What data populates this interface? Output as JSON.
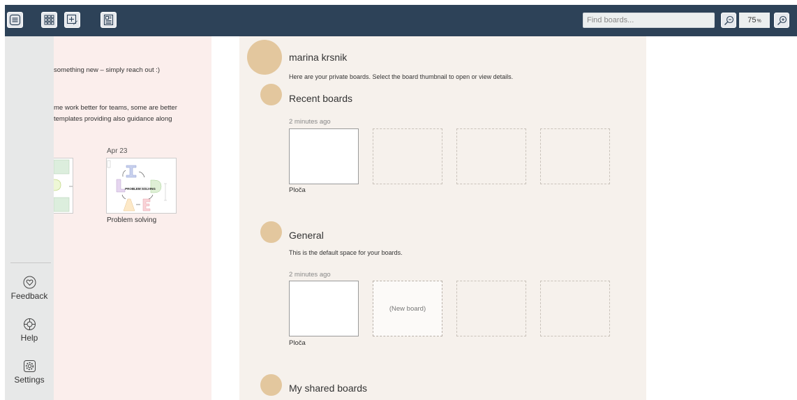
{
  "toolbar": {
    "search_placeholder": "Find boards...",
    "zoom": {
      "value": "75",
      "unit": "%"
    },
    "icons": [
      "menu-icon",
      "grid-icon",
      "new-board-icon",
      "templates-icon",
      "zoom-out-icon",
      "zoom-in-icon"
    ]
  },
  "sidebar": {
    "items": [
      {
        "label": "Feedback",
        "icon": "heart-icon"
      },
      {
        "label": "Help",
        "icon": "lifebuoy-icon"
      },
      {
        "label": "Settings",
        "icon": "gear-icon"
      }
    ]
  },
  "templates": {
    "line1": "something new – simply reach out :)",
    "line2": "me work better for teams, some are better",
    "line3": "templates providing also guidance along",
    "item": {
      "date": "Apr 23",
      "name": "Problem solving"
    }
  },
  "main": {
    "username": "marina krsnik",
    "intro": "Here are your private boards. Select the board thumbnail to open or view details.",
    "sections": [
      {
        "title": "Recent boards",
        "description": "",
        "time": "2 minutes ago",
        "board_name": "Ploča"
      },
      {
        "title": "General",
        "description": "This is the default space for your boards.",
        "time": "2 minutes ago",
        "board_name": "Ploča",
        "new_board_label": "(New board)"
      },
      {
        "title": "My shared boards"
      }
    ]
  },
  "colors": {
    "toolbar_bg": "#2d4258",
    "sidebar_bg": "#e7e8e8",
    "templates_bg": "#fbeeec",
    "main_bg": "#f6f1ec",
    "avatar": "#e3c79e"
  }
}
